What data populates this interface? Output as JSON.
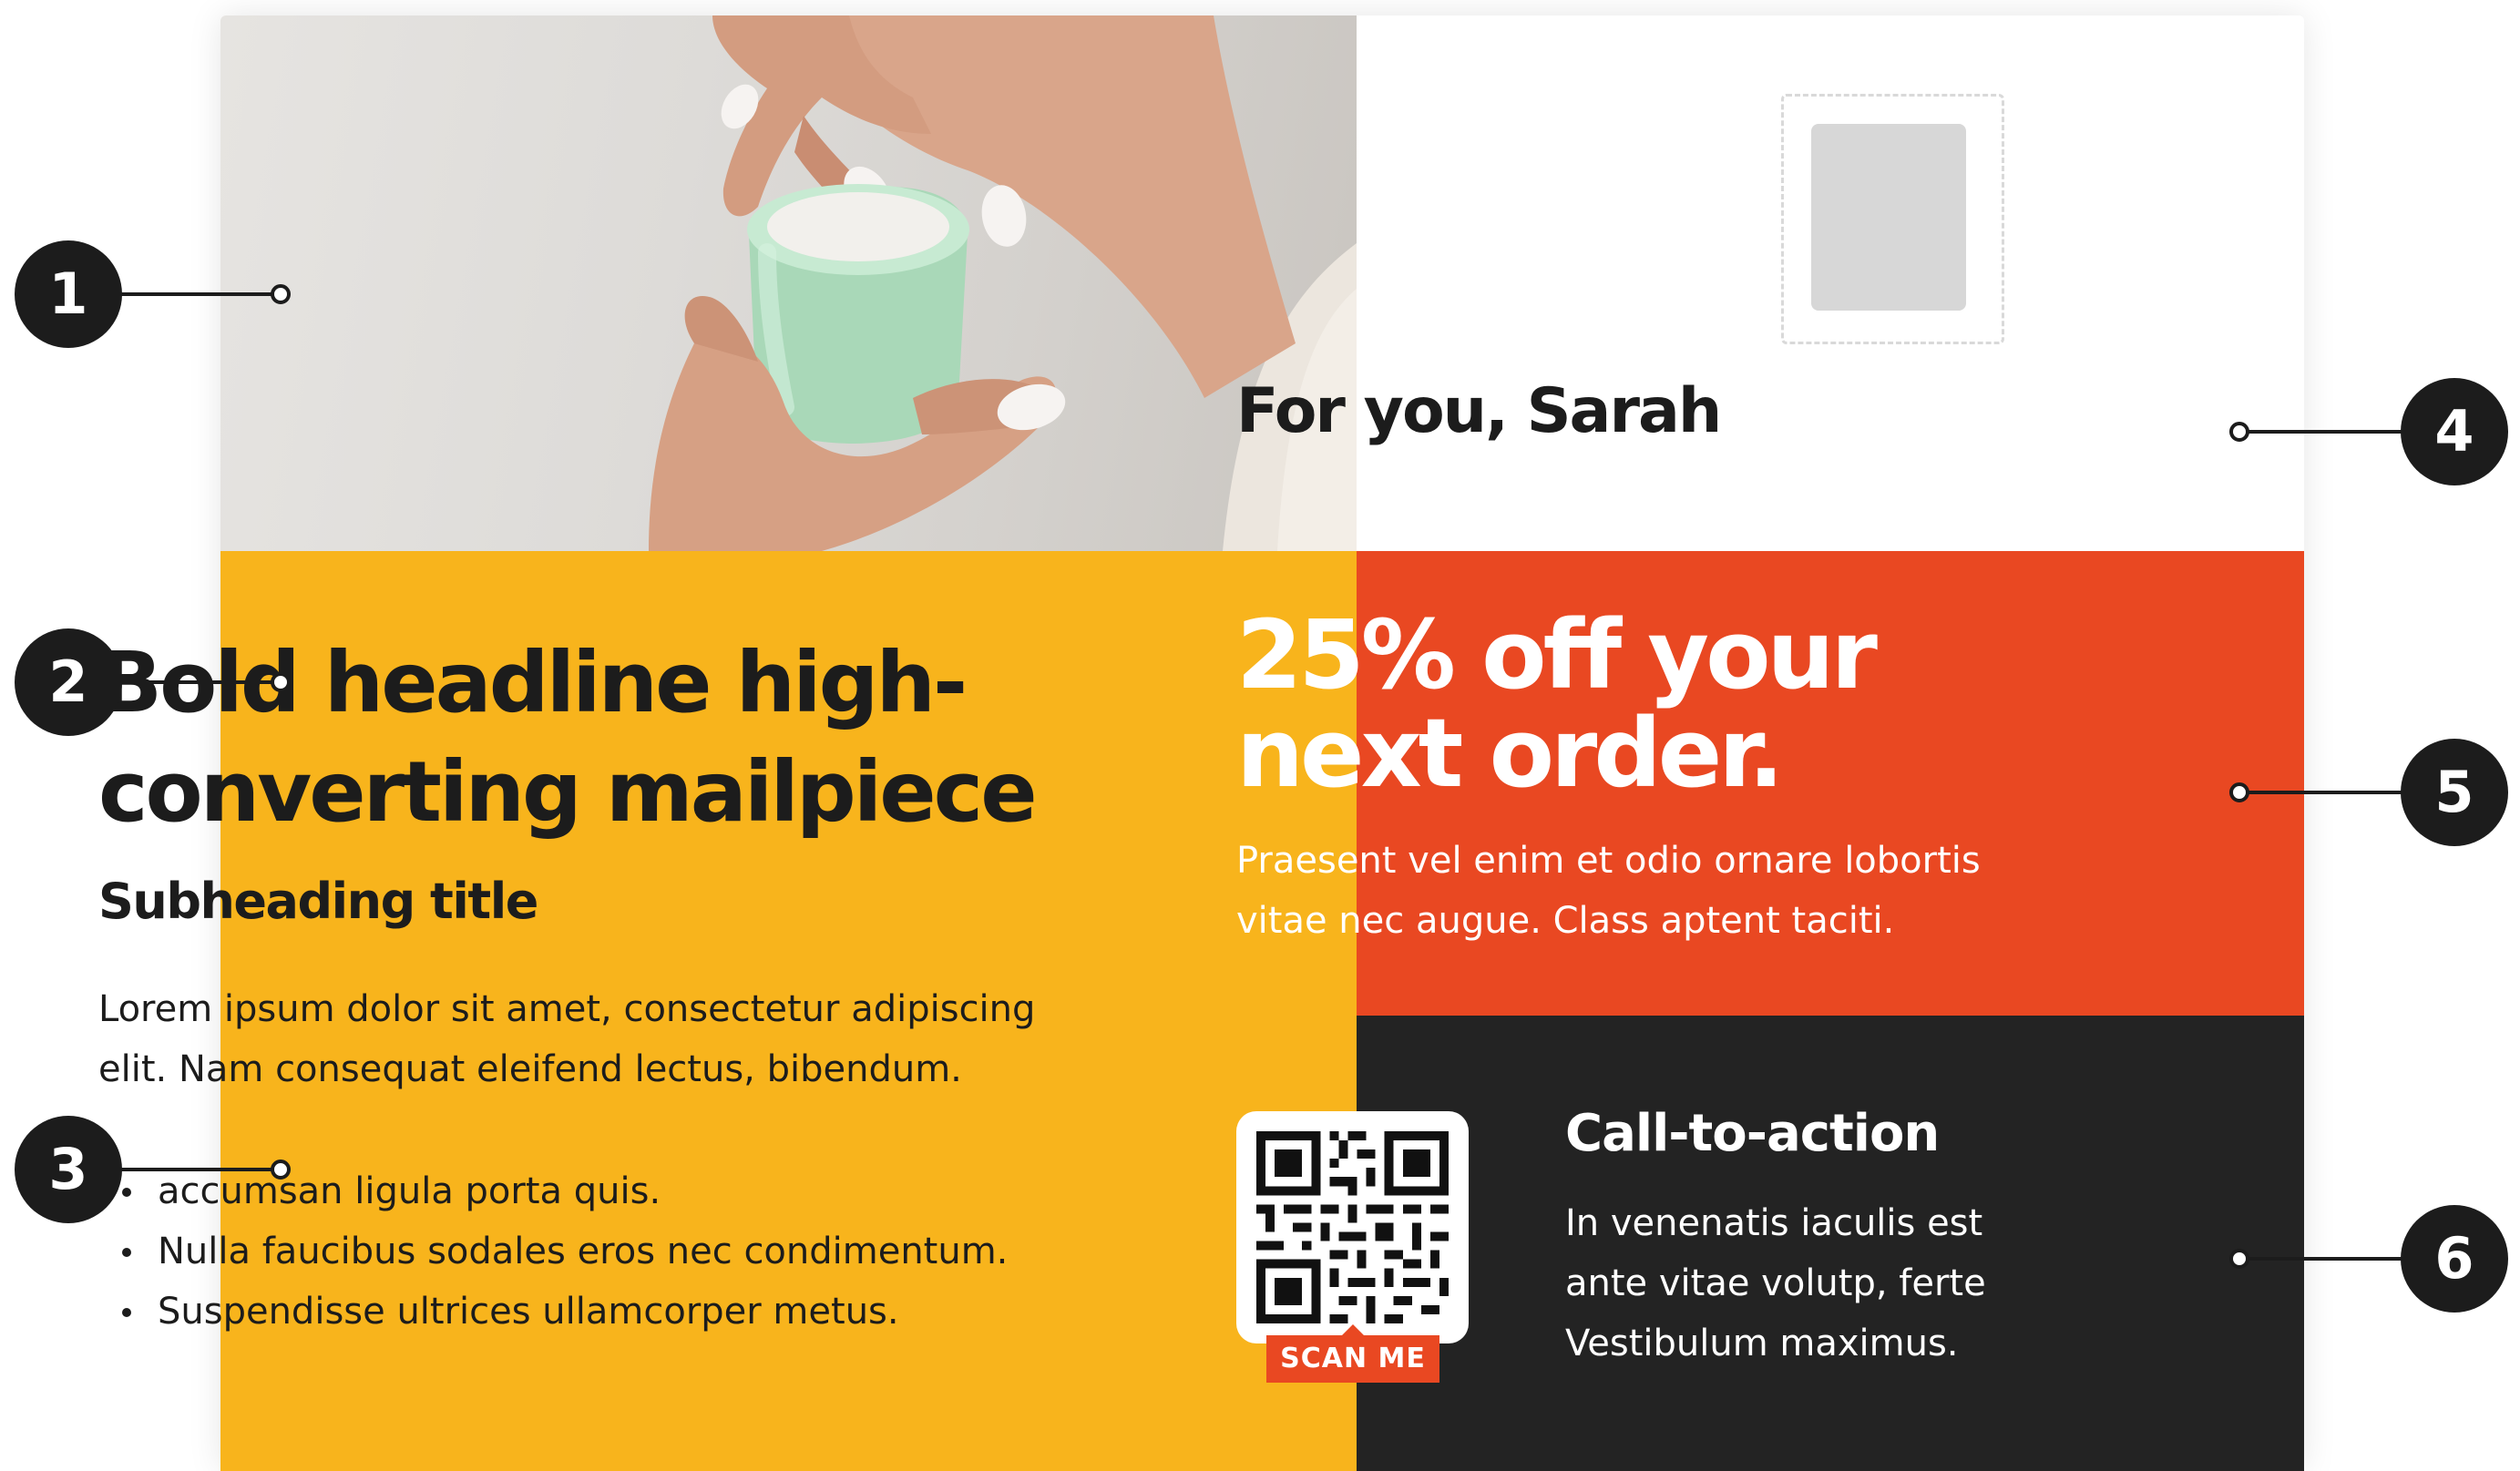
{
  "address": {
    "greeting": "For you, Sarah"
  },
  "promo": {
    "headline": "Bold headline high-converting mailpiece",
    "subheading": "Subheading title",
    "body": "Lorem ipsum dolor sit amet, consectetur adipiscing elit. Nam consequat eleifend lectus, bibendum.",
    "bullets": [
      "accumsan ligula porta quis.",
      "Nulla faucibus sodales eros nec condimentum.",
      "Suspendisse ultrices ullamcorper metus."
    ]
  },
  "offer": {
    "headline": "25% off your next order.",
    "body": "Praesent vel enim et odio ornare lobortis vitae nec augue. Class aptent taciti."
  },
  "cta": {
    "qr_badge": "SCAN ME",
    "title": "Call-to-action",
    "body": "In venenatis iaculis est ante vitae volutp, ferte Vestibulum maximus."
  },
  "callouts": [
    "1",
    "2",
    "3",
    "4",
    "5",
    "6"
  ],
  "colors": {
    "yellow_panel": "#f8b41c",
    "red_panel": "#e94822",
    "dark_panel": "#232323",
    "text_dark": "#1c1c1c"
  }
}
